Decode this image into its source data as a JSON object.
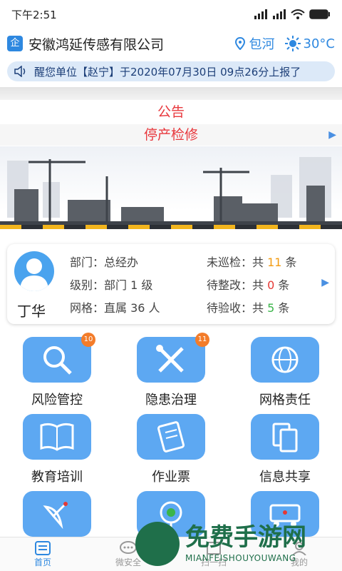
{
  "status_bar": {
    "time": "下午2:51"
  },
  "header": {
    "logo_text": "企",
    "company": "安徽鸿延传感有限公司",
    "location": "包河",
    "temperature": "30°C"
  },
  "marquee": {
    "text": "醒您单位【赵宁】于2020年07月30日 09点26分上报了"
  },
  "notice": {
    "title": "公告",
    "subtitle": "停产检修"
  },
  "user_card": {
    "name": "丁华",
    "department": "部门：总经办",
    "level": "级别：部门 1 级",
    "grid": "网格：直属 36 人",
    "uninspected_prefix": "未巡检：共 ",
    "uninspected_count": "11",
    "uninspected_suffix": " 条",
    "pending_fix_prefix": "待整改：共 ",
    "pending_fix_count": "0",
    "pending_fix_suffix": " 条",
    "pending_accept_prefix": "待验收：共 ",
    "pending_accept_count": "5",
    "pending_accept_suffix": " 条"
  },
  "tiles": [
    {
      "label": "风险管控",
      "badge": "10",
      "icon": "magnifier-icon"
    },
    {
      "label": "隐患治理",
      "badge": "11",
      "icon": "tools-icon"
    },
    {
      "label": "网格责任",
      "badge": "",
      "icon": "network-globe-icon"
    },
    {
      "label": "教育培训",
      "badge": "",
      "icon": "book-icon"
    },
    {
      "label": "作业票",
      "badge": "",
      "icon": "ticket-icon"
    },
    {
      "label": "信息共享",
      "badge": "",
      "icon": "share-docs-icon"
    },
    {
      "label": "",
      "badge": "",
      "icon": "satellite-dish-icon"
    },
    {
      "label": "",
      "badge": "",
      "icon": "camera-icon"
    },
    {
      "label": "",
      "badge": "",
      "icon": "truck-icon"
    }
  ],
  "tabbar": {
    "home": "首页",
    "wechat_safety": "微安全",
    "scan": "扫一扫",
    "mine": "我的"
  },
  "watermark": {
    "big": "免费手游网",
    "small": "MIANFEISHOUYOUWANG"
  }
}
